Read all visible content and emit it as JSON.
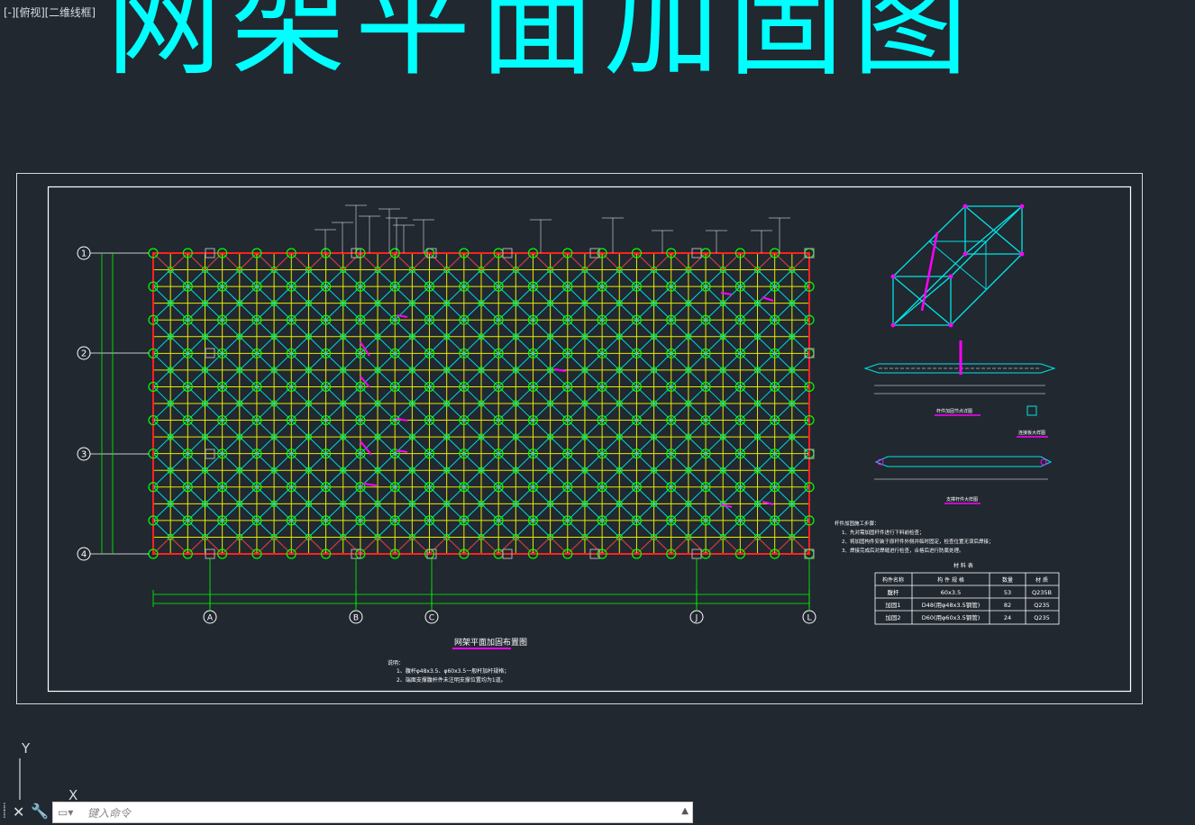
{
  "viewport": {
    "label": "[-][俯视][二维线框]"
  },
  "drawing": {
    "big_title": "网架平面加固图",
    "plan_title": "网架平面加固布置图",
    "notes_header": "说明：",
    "notes": [
      "1、腹杆φ48x3.5、φ60x3.5一般杆加杆规格；",
      "2、端面支撑腹杆件未注明支撑位置均为1道。"
    ],
    "row_axes": [
      "1",
      "2",
      "3",
      "4"
    ],
    "column_axes": [
      "A",
      "B",
      "C",
      "J",
      "L"
    ],
    "detail_labels": {
      "rod_detail": "杆件加固节点详图",
      "connector_detail": "连接板大样图",
      "support_detail": "支撑杆件大样图"
    },
    "construction_notes_title": "杆件加固施工步骤：",
    "construction_notes": [
      "1、先对需加固杆件进行下料前检查；",
      "2、将加固构件安装于原杆件外侧并临时固定，检查位置无误后焊接；",
      "3、焊接完成后对焊缝进行检查，合格后进行防腐处理。"
    ],
    "material_table": {
      "title": "材 料 表",
      "headers": [
        "构件名称",
        "构 件 规 格",
        "数量",
        "材 质"
      ],
      "rows": [
        [
          "腹杆",
          "60x3.5",
          "53",
          "Q235B"
        ],
        [
          "加固1",
          "D48(用φ48x3.5钢管)",
          "82",
          "Q235"
        ],
        [
          "加固2",
          "D60(用φ60x3.5钢管)",
          "24",
          "Q235"
        ]
      ]
    }
  },
  "ucs": {
    "y_label": "Y",
    "x_label": "X"
  },
  "command_line": {
    "placeholder": "键入命令"
  },
  "colors": {
    "background": "#212830",
    "title": "#00ffff",
    "grid_yellow": "#ffff00",
    "web_cyan": "#00e5e5",
    "node_green": "#00ff00",
    "boundary_red": "#ff2020",
    "highlight_magenta": "#ff00ff",
    "frame": "#ffffff"
  }
}
